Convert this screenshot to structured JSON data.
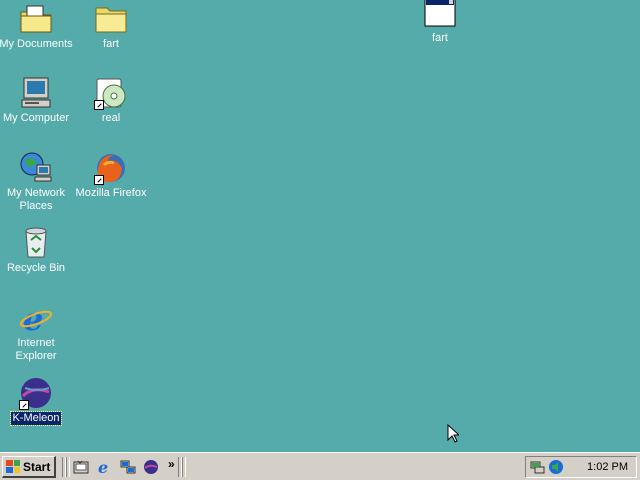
{
  "desktop": {
    "background_color": "#55aaaa",
    "icons": [
      {
        "label": "My Documents",
        "icon": "my-documents-icon"
      },
      {
        "label": "fart",
        "icon": "folder-icon"
      },
      {
        "label": "fart",
        "icon": "window-icon"
      },
      {
        "label": "My Computer",
        "icon": "my-computer-icon"
      },
      {
        "label": "real",
        "icon": "realplayer-icon"
      },
      {
        "label": "My Network Places",
        "icon": "network-places-icon"
      },
      {
        "label": "Mozilla Firefox",
        "icon": "firefox-icon"
      },
      {
        "label": "Recycle Bin",
        "icon": "recycle-bin-icon"
      },
      {
        "label": "Internet Explorer",
        "icon": "internet-explorer-icon"
      },
      {
        "label": "K-Meleon",
        "icon": "k-meleon-icon",
        "selected": true
      }
    ]
  },
  "taskbar": {
    "start_label": "Start",
    "quick_launch": [
      "show-desktop-icon",
      "internet-explorer-icon",
      "network-icon",
      "k-meleon-icon"
    ],
    "chevron": "»",
    "tray_icons": [
      "network-status-icon",
      "volume-icon"
    ],
    "clock": "1:02 PM"
  }
}
